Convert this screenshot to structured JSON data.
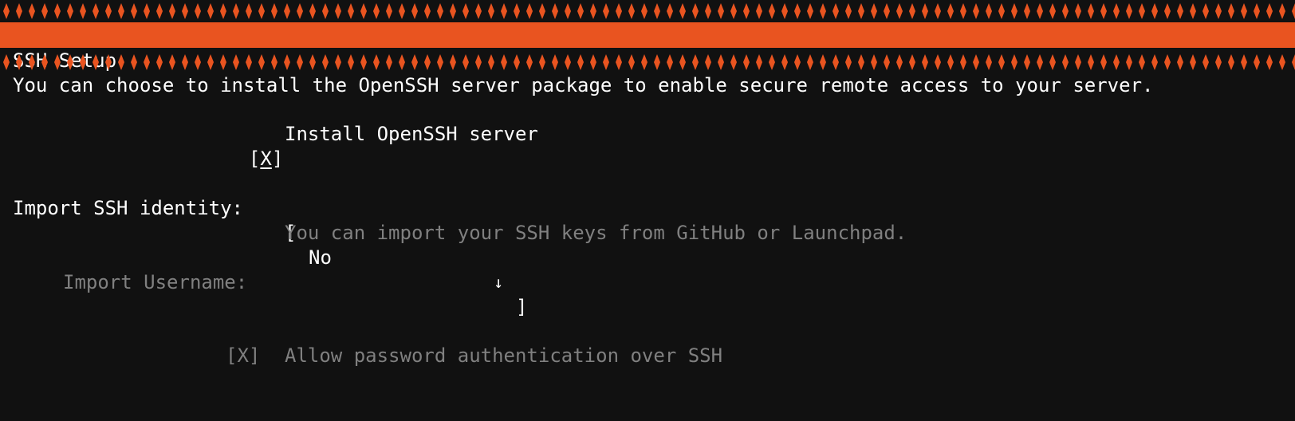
{
  "header": {
    "title": "SSH Setup",
    "accent_color": "#E95420",
    "background_color": "#111111"
  },
  "intro": {
    "text": "You can choose to install the OpenSSH server package to enable secure remote access to your server."
  },
  "install_openssh": {
    "checkbox_open": "[",
    "checkbox_mark": "X",
    "checkbox_close": "]",
    "checked": true,
    "label": "Install OpenSSH server"
  },
  "import_identity": {
    "label": "Import SSH identity:",
    "select_open": "[",
    "selected_value": "No",
    "arrow": "↓",
    "select_close": "]",
    "help_text": "You can import your SSH keys from GitHub or Launchpad."
  },
  "import_username": {
    "label": "Import Username:",
    "value": ""
  },
  "password_auth": {
    "checkbox": "[X]",
    "checked": true,
    "label": "Allow password authentication over SSH"
  }
}
